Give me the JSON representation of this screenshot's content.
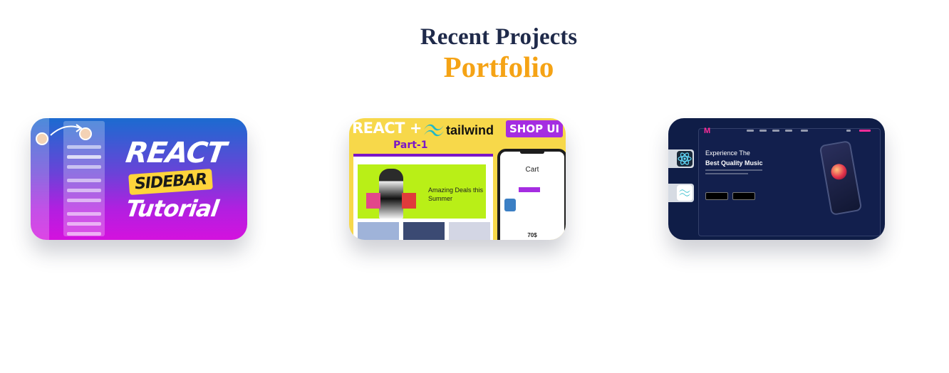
{
  "header": {
    "subtitle": "Recent Projects",
    "title": "Portfolio"
  },
  "projects": [
    {
      "id": "react-sidebar",
      "heading": [
        "REACT",
        "SIDEBAR",
        "Tutorial"
      ]
    },
    {
      "id": "tailwind-shop",
      "banner": "REACT +",
      "brand": "tailwind",
      "badge": "SHOP UI",
      "part": "Part-1",
      "deal": "Amazing Deals this Summer",
      "cart": "Cart",
      "price": "70$"
    },
    {
      "id": "music-app",
      "line1": "Experience The",
      "line2": "Best Quality Music",
      "icons": [
        "react-icon",
        "tailwind-icon"
      ]
    }
  ],
  "colors": {
    "subtitle": "#1f2a4a",
    "title": "#f5a315",
    "shop_accent": "#a52de1",
    "music_bg": "#0f1d47"
  }
}
